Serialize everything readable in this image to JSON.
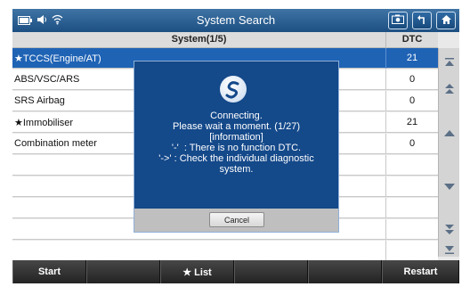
{
  "titlebar": {
    "title": "System Search",
    "status_icons": [
      "battery-icon",
      "speaker-icon",
      "wifi-icon"
    ],
    "buttons": [
      "camera-icon",
      "back-arrow-icon",
      "home-icon"
    ]
  },
  "table": {
    "header_system": "System(1/5)",
    "header_dtc": "DTC",
    "rows": [
      {
        "name": "★TCCS(Engine/AT)",
        "dtc": "21"
      },
      {
        "name": "ABS/VSC/ARS",
        "dtc": "0"
      },
      {
        "name": "SRS Airbag",
        "dtc": "0"
      },
      {
        "name": "★Immobiliser",
        "dtc": "21"
      },
      {
        "name": "Combination meter",
        "dtc": "0"
      },
      {
        "name": "",
        "dtc": ""
      },
      {
        "name": "",
        "dtc": ""
      },
      {
        "name": "",
        "dtc": ""
      },
      {
        "name": "",
        "dtc": ""
      },
      {
        "name": "",
        "dtc": ""
      }
    ]
  },
  "dialog": {
    "line1": "Connecting.",
    "line2": "Please wait a moment. (1/27)",
    "line3": "[information]",
    "line4": "'-'  : There is no function DTC.",
    "line5": "'->' : Check the individual diagnostic",
    "line6": "system.",
    "cancel_label": "Cancel"
  },
  "bottombar": {
    "start_label": "Start",
    "list_label": "★ List",
    "restart_label": "Restart"
  },
  "colors": {
    "titlebar": "#1d4f82",
    "selected_row": "#1f63b5",
    "dialog_bg": "#14498a"
  }
}
